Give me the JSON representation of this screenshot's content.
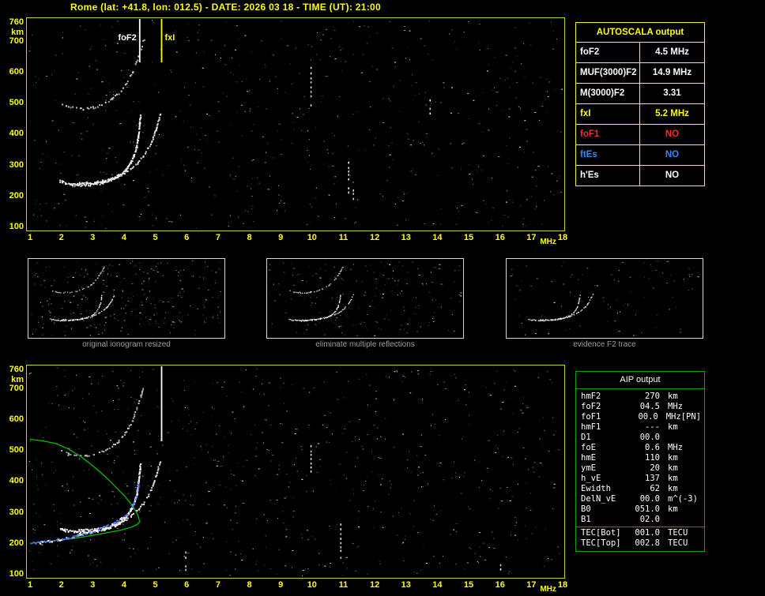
{
  "title": "Rome (lat: +41.8, lon: 012.5) - DATE: 2026 03 18 - TIME (UT): 21:00",
  "colors": {
    "accent_yellow": "#ffff00",
    "plot_border": "#cfcf00",
    "table_green": "#00a800",
    "profile_green": "#00c000",
    "trace_blue": "#5a74ff",
    "status_red": "#ff2a2a",
    "status_blue": "#2e8bff",
    "caption_gray": "#9c9c9c"
  },
  "axes": {
    "x_ticks": [
      "1",
      "2",
      "3",
      "4",
      "5",
      "6",
      "7",
      "8",
      "9",
      "10",
      "11",
      "12",
      "13",
      "14",
      "15",
      "16",
      "17",
      "18"
    ],
    "x_unit": "MHz",
    "y_values": [
      760,
      700,
      600,
      500,
      400,
      300,
      200,
      100
    ],
    "y_unit": "km"
  },
  "autoscala": {
    "header": "AUTOSCALA output",
    "rows": [
      {
        "label": "foF2",
        "value": "4.5 MHz",
        "color": "#ffffff"
      },
      {
        "label": "MUF(3000)F2",
        "value": "14.9 MHz",
        "color": "#ffffff"
      },
      {
        "label": "M(3000)F2",
        "value": "3.31",
        "color": "#ffffff"
      },
      {
        "label": "fxI",
        "value": "5.2 MHz",
        "color": "#ffff00"
      },
      {
        "label": "foF1",
        "value": "NO",
        "color": "#ff2a2a"
      },
      {
        "label": "ftEs",
        "value": "NO",
        "color": "#2e8bff"
      },
      {
        "label": "h'Es",
        "value": "NO",
        "color": "#ffffff"
      }
    ]
  },
  "aip": {
    "header": "AIP output",
    "rows": [
      {
        "name": "hmF2",
        "value": "270",
        "unit": "km"
      },
      {
        "name": "foF2",
        "value": "04.5",
        "unit": "MHz"
      },
      {
        "name": "foF1",
        "value": "00.0",
        "unit": "MHz",
        "note": "[PN]"
      },
      {
        "name": "hmF1",
        "value": "---",
        "unit": "km"
      },
      {
        "name": "D1",
        "value": "00.0",
        "unit": ""
      },
      {
        "name": "foE",
        "value": "0.6",
        "unit": "MHz"
      },
      {
        "name": "hmE",
        "value": "110",
        "unit": "km"
      },
      {
        "name": "ymE",
        "value": "20",
        "unit": "km"
      },
      {
        "name": "h_vE",
        "value": "137",
        "unit": "km"
      },
      {
        "name": "Ewidth",
        "value": "62",
        "unit": "km"
      },
      {
        "name": "DelN_vE",
        "value": "00.0",
        "unit": "m^(-3)"
      },
      {
        "name": "B0",
        "value": "051.0",
        "unit": "km"
      },
      {
        "name": "B1",
        "value": "02.0",
        "unit": ""
      }
    ],
    "tec_rows": [
      {
        "name": "TEC[Bot]",
        "value": "001.0",
        "unit": "TECU"
      },
      {
        "name": "TEC[Top]",
        "value": "002.8",
        "unit": "TECU"
      }
    ]
  },
  "thumbnails": [
    {
      "caption": "original ionogram resized",
      "series": [
        "second_hop",
        "f2_x",
        "f2_o"
      ],
      "noise_count": 260,
      "seed": 21
    },
    {
      "caption": "eliminate multiple reflections",
      "series": [
        "second_hop",
        "f2_x",
        "f2_o"
      ],
      "noise_count": 185,
      "seed": 22
    },
    {
      "caption": "evidence F2 trace",
      "series": [
        "f2_x",
        "f2_o"
      ],
      "noise_count": 95,
      "seed": 23
    }
  ],
  "chart_data": {
    "type": "scatter",
    "xlabel": "MHz",
    "ylabel": "km",
    "xlim": [
      1,
      18
    ],
    "ylim": [
      100,
      760
    ],
    "traces": {
      "f2_o": {
        "desc": "F2 ordinary echo trace (virtual height km vs MHz)",
        "points": [
          [
            1.95,
            252
          ],
          [
            2.1,
            247
          ],
          [
            2.3,
            243
          ],
          [
            2.5,
            241
          ],
          [
            2.7,
            241
          ],
          [
            2.9,
            242
          ],
          [
            3.1,
            245
          ],
          [
            3.3,
            249
          ],
          [
            3.5,
            255
          ],
          [
            3.7,
            263
          ],
          [
            3.85,
            272
          ],
          [
            4.0,
            284
          ],
          [
            4.1,
            297
          ],
          [
            4.2,
            313
          ],
          [
            4.3,
            335
          ],
          [
            4.38,
            362
          ],
          [
            4.44,
            398
          ],
          [
            4.48,
            435
          ],
          [
            4.5,
            462
          ]
        ]
      },
      "f2_x": {
        "desc": "F2 extraordinary echo trace",
        "points": [
          [
            2.55,
            248
          ],
          [
            2.8,
            246
          ],
          [
            3.05,
            248
          ],
          [
            3.3,
            252
          ],
          [
            3.55,
            258
          ],
          [
            3.8,
            267
          ],
          [
            4.0,
            277
          ],
          [
            4.2,
            291
          ],
          [
            4.4,
            309
          ],
          [
            4.6,
            332
          ],
          [
            4.75,
            356
          ],
          [
            4.9,
            388
          ],
          [
            5.0,
            418
          ],
          [
            5.08,
            448
          ],
          [
            5.14,
            468
          ]
        ]
      },
      "second_hop": {
        "desc": "second-hop multiple reflection trace",
        "points": [
          [
            2.0,
            500
          ],
          [
            2.2,
            491
          ],
          [
            2.4,
            486
          ],
          [
            2.6,
            484
          ],
          [
            2.8,
            485
          ],
          [
            3.0,
            489
          ],
          [
            3.2,
            495
          ],
          [
            3.4,
            504
          ],
          [
            3.6,
            517
          ],
          [
            3.8,
            533
          ],
          [
            3.95,
            550
          ],
          [
            4.1,
            572
          ],
          [
            4.25,
            600
          ],
          [
            4.35,
            628
          ],
          [
            4.45,
            655
          ],
          [
            4.55,
            685
          ],
          [
            4.62,
            710
          ]
        ]
      },
      "restored_trace": {
        "desc": "AIP restored trace (blue points)",
        "points": [
          [
            1.05,
            203
          ],
          [
            1.3,
            206
          ],
          [
            1.6,
            210
          ],
          [
            1.9,
            215
          ],
          [
            2.2,
            221
          ],
          [
            2.5,
            228
          ],
          [
            2.8,
            236
          ],
          [
            3.1,
            245
          ],
          [
            3.4,
            256
          ],
          [
            3.7,
            270
          ],
          [
            3.9,
            283
          ],
          [
            4.1,
            300
          ],
          [
            4.25,
            320
          ],
          [
            4.35,
            345
          ],
          [
            4.42,
            375
          ],
          [
            4.47,
            408
          ]
        ]
      },
      "profile": {
        "desc": "AIP electron density profile, plasma frequency vs real height (green line)",
        "line": true,
        "points": [
          [
            1.0,
            537
          ],
          [
            1.4,
            532
          ],
          [
            1.8,
            524
          ],
          [
            2.2,
            507
          ],
          [
            2.6,
            483
          ],
          [
            3.0,
            452
          ],
          [
            3.4,
            417
          ],
          [
            3.7,
            387
          ],
          [
            4.0,
            356
          ],
          [
            4.2,
            331
          ],
          [
            4.35,
            310
          ],
          [
            4.45,
            290
          ],
          [
            4.5,
            271
          ],
          [
            4.42,
            262
          ],
          [
            4.2,
            252
          ],
          [
            3.9,
            244
          ],
          [
            3.5,
            236
          ],
          [
            3.1,
            229
          ],
          [
            2.7,
            222
          ],
          [
            2.3,
            216
          ],
          [
            1.9,
            211
          ],
          [
            1.5,
            206
          ],
          [
            1.0,
            201
          ]
        ]
      }
    },
    "plots": [
      {
        "id": "top",
        "series": [
          "second_hop",
          "f2_x",
          "f2_o"
        ],
        "markers": [
          {
            "name": "foF2",
            "f": 4.5,
            "color": "#ffffff",
            "label": "foF2",
            "len": 55
          },
          {
            "name": "fxI",
            "f": 5.2,
            "color": "#ffff00",
            "label": "fxI",
            "len": 55
          }
        ],
        "noise_count": 620,
        "seed": 11,
        "streaks": [
          {
            "f": 9.95,
            "h1": 495,
            "h2": 618
          },
          {
            "f": 11.15,
            "h1": 205,
            "h2": 312
          },
          {
            "f": 11.3,
            "h1": 180,
            "h2": 240
          },
          {
            "f": 13.75,
            "h1": 470,
            "h2": 525
          }
        ]
      },
      {
        "id": "bottom",
        "series": [
          "second_hop",
          "f2_x",
          "f2_o",
          "profile",
          "restored_trace"
        ],
        "markers": [
          {
            "name": "fxI",
            "f": 5.2,
            "color": "#ffffff",
            "label": "",
            "len": 95
          }
        ],
        "noise_count": 730,
        "seed": 77,
        "streaks": [
          {
            "f": 9.95,
            "h1": 425,
            "h2": 530
          },
          {
            "f": 10.9,
            "h1": 150,
            "h2": 265
          },
          {
            "f": 5.95,
            "h1": 118,
            "h2": 175
          },
          {
            "f": 16.0,
            "h1": 110,
            "h2": 150
          }
        ]
      }
    ]
  }
}
